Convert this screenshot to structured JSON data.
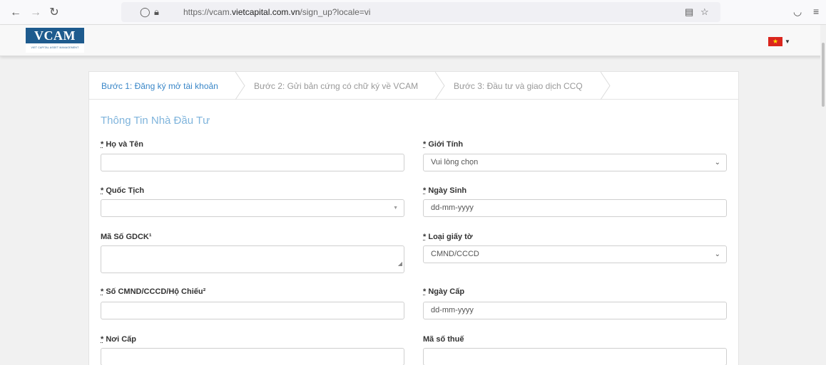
{
  "browser": {
    "url_prefix": "https://vcam.",
    "url_domain": "vietcapital.com.vn",
    "url_suffix": "/sign_up?locale=vi"
  },
  "header": {
    "logo_text": "VCAM",
    "logo_subtext": "VIET CAPITAL ASSET MANAGEMENT"
  },
  "steps": [
    {
      "label": "Bước 1: Đăng ký mở tài khoản"
    },
    {
      "label": "Bước 2: Gửi bản cứng có chữ ký về VCAM"
    },
    {
      "label": "Bước 3: Đầu tư và giao dịch CCQ"
    }
  ],
  "form": {
    "section_title": "Thông Tin Nhà Đầu Tư",
    "required_mark": "*",
    "full_name": {
      "label": "Họ và Tên",
      "value": ""
    },
    "gender": {
      "label": "Giới Tính",
      "value": "Vui lòng chọn"
    },
    "nationality": {
      "label": "Quốc Tịch",
      "value": ""
    },
    "dob": {
      "label": "Ngày Sinh",
      "placeholder": "dd-mm-yyyy"
    },
    "gdck": {
      "label": "Mã Số GDCK¹",
      "value": ""
    },
    "id_type": {
      "label": "Loại giấy tờ",
      "value": "CMND/CCCD"
    },
    "id_number": {
      "label": "Số CMND/CCCD/Hộ Chiếu²",
      "value": ""
    },
    "issue_date": {
      "label": "Ngày Cấp",
      "placeholder": "dd-mm-yyyy"
    },
    "issue_place": {
      "label": "Nơi Cấp",
      "value": ""
    },
    "tax_code": {
      "label": "Mã số thuế",
      "value": ""
    }
  },
  "colors": {
    "brand": "#1e5b8e",
    "active_step": "#3a87c8",
    "section_title": "#7fb4dc"
  }
}
